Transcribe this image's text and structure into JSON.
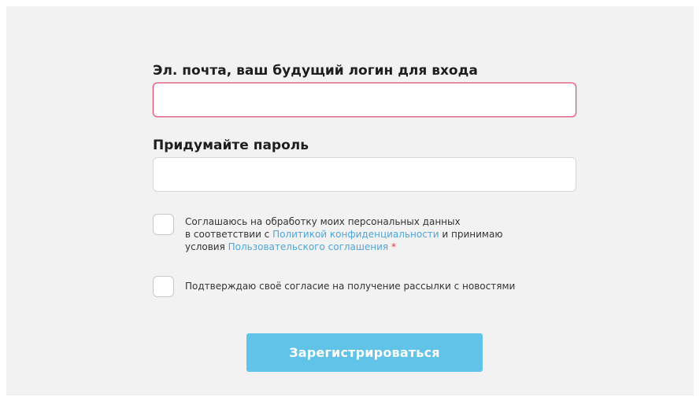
{
  "form": {
    "email": {
      "label": "Эл. почта, ваш будущий логин для входа",
      "value": "",
      "placeholder": ""
    },
    "password": {
      "label": "Придумайте пароль",
      "value": "",
      "placeholder": ""
    },
    "consent": {
      "checked": false,
      "line1": "Соглашаюсь на обработку моих персональных данных",
      "line2_prefix": "в соответствии с ",
      "privacy_link": "Политикой конфиденциальности",
      "line2_suffix": " и принимаю",
      "line3_prefix": "условия ",
      "terms_link": "Пользовательского соглашения",
      "required_mark": " *"
    },
    "newsletter": {
      "checked": false,
      "label": "Подтверждаю своё согласие на получение рассылки с новостями"
    },
    "submit_label": "Зарегистрироваться"
  },
  "colors": {
    "panel_background": "#f2f2f2",
    "active_input_border": "#e0406a",
    "link": "#4fa6d8",
    "required": "#e53935",
    "button": "#62c3e8",
    "button_text": "#ffffff"
  }
}
